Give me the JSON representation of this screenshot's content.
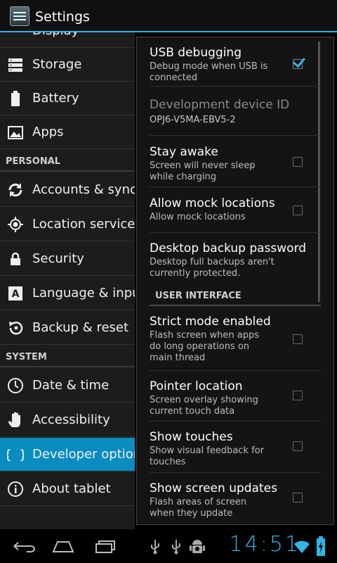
{
  "header": {
    "title": "Settings"
  },
  "left_nav": {
    "partial_item": "Display",
    "items_top": [
      {
        "label": "Storage",
        "icon": "storage-icon"
      },
      {
        "label": "Battery",
        "icon": "battery-icon"
      },
      {
        "label": "Apps",
        "icon": "apps-icon"
      }
    ],
    "section_personal": "PERSONAL",
    "items_personal": [
      {
        "label": "Accounts & sync",
        "icon": "sync-icon"
      },
      {
        "label": "Location services",
        "icon": "location-icon"
      },
      {
        "label": "Security",
        "icon": "lock-icon"
      },
      {
        "label": "Language & input",
        "icon": "language-icon"
      },
      {
        "label": "Backup & reset",
        "icon": "backup-icon"
      }
    ],
    "section_system": "SYSTEM",
    "items_system": [
      {
        "label": "Date & time",
        "icon": "clock-icon"
      },
      {
        "label": "Accessibility",
        "icon": "hand-icon"
      },
      {
        "label": "Developer options",
        "icon": "braces-icon",
        "selected": true
      },
      {
        "label": "About tablet",
        "icon": "info-icon"
      }
    ]
  },
  "developer": {
    "prefs": [
      {
        "title": "USB debugging",
        "summary": "Debug mode when USB is connected",
        "checked": true
      },
      {
        "title": "Development device ID",
        "summary": "OPJ6-V5MA-EBV5-2",
        "disabled": true
      },
      {
        "title": "Stay awake",
        "summary": "Screen will never sleep while charging",
        "checked": false
      },
      {
        "title": "Allow mock locations",
        "summary": "Allow mock locations",
        "checked": false
      },
      {
        "title": "Desktop backup password",
        "summary": "Desktop full backups aren't currently protected."
      }
    ],
    "section_ui": "USER INTERFACE",
    "ui_prefs": [
      {
        "title": "Strict mode enabled",
        "summary": "Flash screen when apps do long operations on main thread",
        "checked": false
      },
      {
        "title": "Pointer location",
        "summary": "Screen overlay showing current touch data",
        "checked": false
      },
      {
        "title": "Show touches",
        "summary": "Show visual feedback for touches",
        "checked": false
      },
      {
        "title": "Show screen updates",
        "summary": "Flash areas of screen when they update",
        "checked": false
      }
    ]
  },
  "status": {
    "time": "14:51"
  },
  "colors": {
    "accent": "#33b5e5",
    "selected_bg": "#0a8cc0"
  }
}
